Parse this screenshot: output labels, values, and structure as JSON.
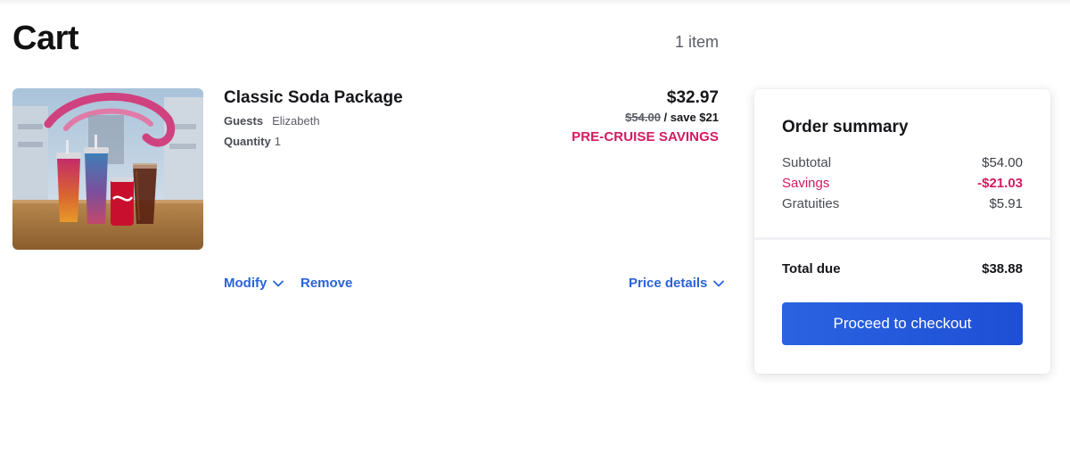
{
  "header": {
    "title": "Cart",
    "item_count": "1 item"
  },
  "cart_item": {
    "name": "Classic Soda Package",
    "guests_label": "Guests",
    "guests_value": "Elizabeth",
    "quantity_label": "Quantity",
    "quantity_value": "1",
    "price_now": "$32.97",
    "price_was": "$54.00",
    "save_text": " / save $21",
    "savings_label": "PRE-CRUISE SAVINGS",
    "actions": {
      "modify": "Modify",
      "remove": "Remove",
      "price_details": "Price details"
    }
  },
  "summary": {
    "title": "Order summary",
    "subtotal_label": "Subtotal",
    "subtotal_value": "$54.00",
    "savings_label": "Savings",
    "savings_value": "-$21.03",
    "gratuities_label": "Gratuities",
    "gratuities_value": "$5.91",
    "total_label": "Total due",
    "total_value": "$38.88",
    "checkout_label": "Proceed to checkout"
  },
  "colors": {
    "accent_blue": "#2a63d8",
    "savings_pink": "#d6195f"
  },
  "icons": {
    "modify_chevron": "chevron-down-icon",
    "price_details_chevron": "chevron-down-icon"
  }
}
